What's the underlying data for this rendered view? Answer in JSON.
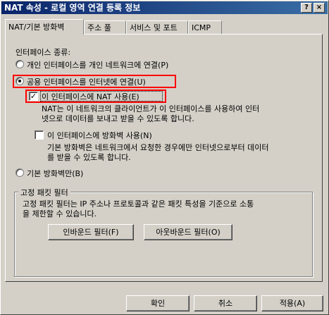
{
  "window": {
    "title": "NAT 속성 - 로컬 영역 연결 등록 정보",
    "help_button": "?",
    "close_button": "×"
  },
  "tabs": [
    {
      "label": "NAT/기본 방화벽",
      "active": true
    },
    {
      "label": "주소 풀",
      "active": false
    },
    {
      "label": "서비스 및 포트",
      "active": false
    },
    {
      "label": "ICMP",
      "active": false
    }
  ],
  "interface_type": {
    "label": "인터페이스 종류:",
    "options": [
      {
        "label": "개인 인터페이스를 개인 네트워크에 연결(P)",
        "checked": false
      },
      {
        "label": "공용 인터페이스를 인터넷에 연결(U)",
        "checked": true
      }
    ],
    "nat": {
      "label": "이 인터페이스에 NAT 사용(E)",
      "checked": true,
      "description_line1": "NAT는 이 네트워크의 클라이언트가 이 인터페이스를 사용하여 인터",
      "description_line2": "넷으로 데이터를 보내고 받을 수 있도록 합니다."
    },
    "firewall": {
      "label": "이 인터페이스에 방화벽 사용(N)",
      "checked": false,
      "description_line1": "기본 방화벽은 네트워크에서 요청한 경우에만 인터넷으로부터 데이터",
      "description_line2": "를 받을 수 있도록 합니다."
    },
    "basic_firewall_only": {
      "label": "기본 방화벽만(B)",
      "checked": false
    }
  },
  "static_filters": {
    "title": "고정 패킷 필터",
    "description_line1": "고정 패킷 필터는 IP 주소나 프로토콜과 같은 패킷 특성을 기준으로 소통",
    "description_line2": "을 제한할 수 있습니다.",
    "inbound_button": "인바운드 필터(F)",
    "outbound_button": "아웃바운드 필터(O)"
  },
  "footer": {
    "ok_button": "확인",
    "cancel_button": "취소",
    "apply_button": "적용(A)"
  },
  "colors": {
    "highlight": "#ff0000",
    "title_bar": "#0a246a"
  }
}
